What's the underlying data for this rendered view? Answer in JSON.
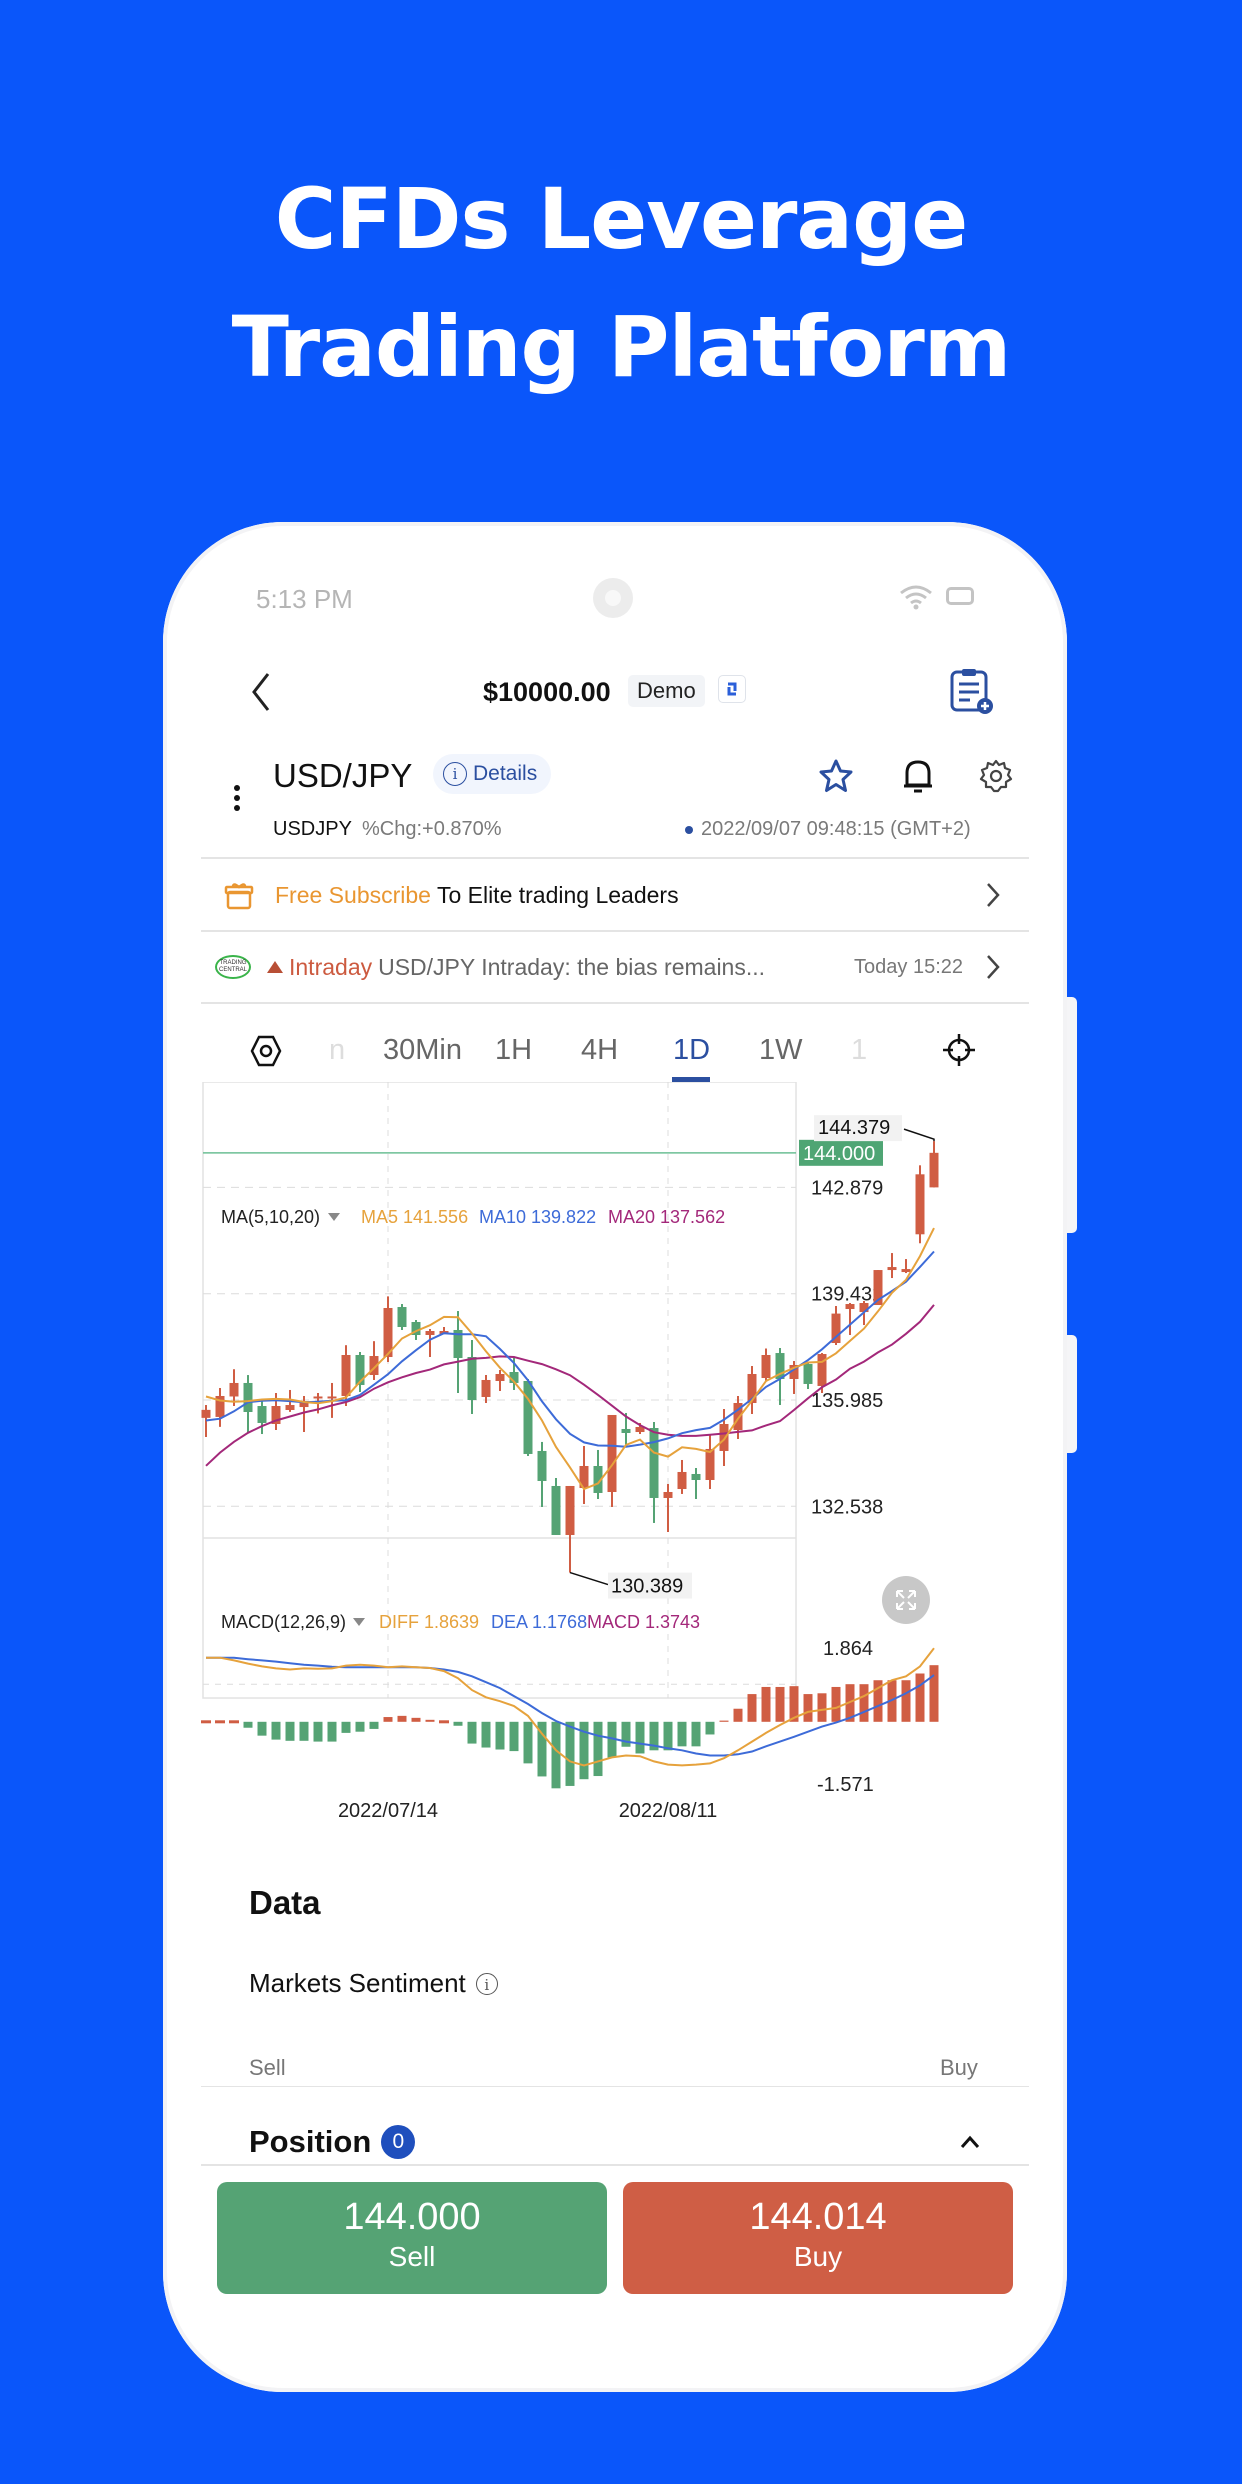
{
  "headline": {
    "line1": "CFDs Leverage",
    "line2": "Trading Platform"
  },
  "status_bar": {
    "time": "5:13 PM",
    "icons": [
      "wifi-icon",
      "battery-icon"
    ]
  },
  "header": {
    "balance": "$10000.00",
    "account_type": "Demo",
    "icons": [
      "back-icon",
      "switch-account-icon",
      "orders-icon"
    ]
  },
  "instrument": {
    "pair": "USD/JPY",
    "details_label": "Details",
    "symbol": "USDJPY",
    "change": "%Chg:+0.870%",
    "timestamp": "2022/09/07 09:48:15 (GMT+2)",
    "icons": [
      "more-icon",
      "favorite-star-icon",
      "alert-bell-icon",
      "settings-gear-icon"
    ]
  },
  "subscribe_banner": {
    "highlight": "Free Subscribe",
    "text": " To Elite trading Leaders"
  },
  "news": {
    "source_logo": "TRADING CENTRAL",
    "tag": "Intraday",
    "headline": "USD/JPY Intraday: the bias remains...",
    "time": "Today 15:22"
  },
  "timeframes": {
    "items": [
      "n",
      "30Min",
      "1H",
      "4H",
      "1D",
      "1W",
      "1"
    ],
    "active": "1D"
  },
  "colors": {
    "up": "#d05d43",
    "down": "#55a374",
    "accent": "#2b4fa0",
    "ma5": "#e6a23c",
    "ma10": "#3d6bd8",
    "ma20": "#a3287a",
    "background": "#0a56fa"
  },
  "chart_data": {
    "type": "candlestick",
    "title": "USD/JPY 1D",
    "main_indicator": {
      "label": "MA(5,10,20)",
      "ma5": "MA5 141.556",
      "ma10": "MA10 139.822",
      "ma20": "MA20 137.562"
    },
    "y_ticks": [
      "142.879",
      "139.432",
      "135.985",
      "132.538"
    ],
    "y_tick_values": [
      142.879,
      139.432,
      135.985,
      132.538
    ],
    "ylim": [
      129.3,
      145.9
    ],
    "current_price": "144.000",
    "current_price_value": 144.0,
    "max_label": "144.379",
    "min_label": "130.389",
    "x_labels": [
      {
        "label": "2022/07/14",
        "index": 13
      },
      {
        "label": "2022/08/11",
        "index": 33
      }
    ],
    "candles": [
      {
        "o": 135.406,
        "h": 135.822,
        "c": 135.665,
        "l": 134.785
      },
      {
        "o": 135.436,
        "h": 136.374,
        "c": 136.115,
        "l": 135.114
      },
      {
        "o": 136.099,
        "h": 136.983,
        "c": 136.537,
        "l": 135.79
      },
      {
        "o": 136.537,
        "h": 136.794,
        "c": 135.596,
        "l": 134.915
      },
      {
        "o": 135.79,
        "h": 136.0,
        "c": 135.24,
        "l": 134.882
      },
      {
        "o": 135.207,
        "h": 136.212,
        "c": 135.79,
        "l": 135.012
      },
      {
        "o": 135.661,
        "h": 136.31,
        "c": 135.822,
        "l": 135.6
      },
      {
        "o": 135.757,
        "h": 136.115,
        "c": 135.95,
        "l": 134.947
      },
      {
        "o": 136.099,
        "h": 136.212,
        "c": 136.099,
        "l": 135.55
      },
      {
        "o": 136.099,
        "h": 136.537,
        "c": 136.099,
        "l": 135.405
      },
      {
        "o": 136.115,
        "h": 137.762,
        "c": 137.444,
        "l": 135.79
      },
      {
        "o": 137.444,
        "h": 137.541,
        "c": 136.472,
        "l": 136.245
      },
      {
        "o": 136.796,
        "h": 137.893,
        "c": 137.411,
        "l": 136.634
      },
      {
        "o": 137.379,
        "h": 139.345,
        "c": 138.968,
        "l": 137.217
      },
      {
        "o": 139.0,
        "h": 139.097,
        "c": 138.352,
        "l": 138.255
      },
      {
        "o": 138.514,
        "h": 138.579,
        "c": 138.093,
        "l": 137.931
      },
      {
        "o": 138.093,
        "h": 138.287,
        "c": 138.222,
        "l": 137.379
      },
      {
        "o": 138.125,
        "h": 138.352,
        "c": 138.222,
        "l": 138.125
      },
      {
        "o": 138.255,
        "h": 138.87,
        "c": 137.347,
        "l": 136.212
      },
      {
        "o": 137.379,
        "h": 137.931,
        "c": 135.985,
        "l": 135.531
      },
      {
        "o": 136.083,
        "h": 136.796,
        "c": 136.634,
        "l": 135.888
      },
      {
        "o": 136.601,
        "h": 136.958,
        "c": 136.828,
        "l": 136.277
      },
      {
        "o": 136.893,
        "h": 137.379,
        "c": 136.537,
        "l": 136.31
      },
      {
        "o": 136.601,
        "h": 136.666,
        "c": 134.235,
        "l": 134.17
      },
      {
        "o": 134.332,
        "h": 134.625,
        "c": 133.359,
        "l": 132.516
      },
      {
        "o": 133.197,
        "h": 133.456,
        "c": 131.608,
        "l": 131.608
      },
      {
        "o": 131.608,
        "h": 133.197,
        "c": 133.197,
        "l": 130.389
      },
      {
        "o": 133.132,
        "h": 134.494,
        "c": 133.845,
        "l": 132.613
      },
      {
        "o": 133.845,
        "h": 134.365,
        "c": 132.97,
        "l": 132.775
      },
      {
        "o": 133.002,
        "h": 135.499,
        "c": 135.499,
        "l": 132.516
      },
      {
        "o": 135.045,
        "h": 135.564,
        "c": 134.915,
        "l": 134.494
      },
      {
        "o": 134.947,
        "h": 135.24,
        "c": 135.11,
        "l": 134.882
      },
      {
        "o": 135.077,
        "h": 135.272,
        "c": 132.808,
        "l": 131.998
      },
      {
        "o": 132.808,
        "h": 133.262,
        "c": 133.002,
        "l": 131.705
      },
      {
        "o": 133.099,
        "h": 134.04,
        "c": 133.651,
        "l": 132.938
      },
      {
        "o": 133.586,
        "h": 133.78,
        "c": 133.391,
        "l": 132.775
      },
      {
        "o": 133.391,
        "h": 134.85,
        "c": 134.397,
        "l": 133.099
      },
      {
        "o": 134.332,
        "h": 135.693,
        "c": 135.207,
        "l": 133.845
      },
      {
        "o": 135.012,
        "h": 136.115,
        "c": 135.888,
        "l": 134.721
      },
      {
        "o": 135.888,
        "h": 137.087,
        "c": 136.828,
        "l": 135.531
      },
      {
        "o": 136.698,
        "h": 137.655,
        "c": 137.444,
        "l": 136.601
      },
      {
        "o": 137.508,
        "h": 137.671,
        "c": 136.666,
        "l": 135.823
      },
      {
        "o": 136.666,
        "h": 137.249,
        "c": 137.12,
        "l": 136.18
      },
      {
        "o": 137.152,
        "h": 137.185,
        "c": 136.505,
        "l": 136.342
      },
      {
        "o": 136.44,
        "h": 137.508,
        "c": 137.476,
        "l": 136.212
      },
      {
        "o": 137.833,
        "h": 139.033,
        "c": 138.787,
        "l": 137.768
      },
      {
        "o": 138.935,
        "h": 139.13,
        "c": 139.097,
        "l": 138.093
      },
      {
        "o": 138.838,
        "h": 139.195,
        "c": 139.13,
        "l": 138.416
      },
      {
        "o": 139.065,
        "h": 140.199,
        "c": 140.199,
        "l": 139.065
      },
      {
        "o": 140.199,
        "h": 140.75,
        "c": 140.296,
        "l": 139.94
      },
      {
        "o": 140.134,
        "h": 140.555,
        "c": 140.231,
        "l": 140.101
      },
      {
        "o": 141.358,
        "h": 143.595,
        "c": 143.303,
        "l": 141.067
      },
      {
        "o": 142.879,
        "h": 144.379,
        "c": 144.0,
        "l": 142.879
      }
    ],
    "ma5": [
      136.1,
      135.97,
      135.93,
      135.95,
      136.0,
      136.02,
      136.0,
      135.92,
      135.88,
      135.95,
      136.07,
      136.58,
      137.02,
      137.48,
      137.98,
      138.22,
      138.41,
      138.68,
      138.67,
      138.14,
      137.56,
      137.03,
      136.58,
      136.02,
      135.32,
      134.46,
      133.8,
      133.1,
      133.28,
      133.87,
      134.53,
      134.7,
      134.28,
      134.15,
      134.45,
      134.4,
      134.3,
      134.7,
      135.38,
      135.97,
      136.6,
      136.83,
      137.03,
      137.2,
      137.22,
      137.5,
      137.9,
      138.3,
      138.86,
      139.46,
      139.88,
      140.65,
      141.56
    ],
    "ma10": [
      135.32,
      135.38,
      135.62,
      135.91,
      135.96,
      135.98,
      135.95,
      135.91,
      135.93,
      135.96,
      135.98,
      136.15,
      136.48,
      136.82,
      137.24,
      137.6,
      137.94,
      138.15,
      138.12,
      138.12,
      138.05,
      137.64,
      137.18,
      136.62,
      135.94,
      135.36,
      134.89,
      134.61,
      134.51,
      134.5,
      134.47,
      134.54,
      134.62,
      134.74,
      134.91,
      135.01,
      135.08,
      135.35,
      135.67,
      136.02,
      136.41,
      136.67,
      136.98,
      137.28,
      137.63,
      138.03,
      138.43,
      138.83,
      139.23,
      139.52,
      139.82,
      140.3,
      140.8
    ],
    "ma20": [
      133.85,
      134.28,
      134.63,
      134.92,
      135.14,
      135.32,
      135.45,
      135.58,
      135.68,
      135.81,
      135.92,
      136.08,
      136.35,
      136.56,
      136.72,
      136.86,
      136.97,
      137.14,
      137.23,
      137.32,
      137.35,
      137.4,
      137.38,
      137.26,
      137.15,
      136.98,
      136.79,
      136.48,
      136.15,
      135.8,
      135.45,
      135.17,
      134.94,
      134.86,
      134.82,
      134.82,
      134.86,
      134.9,
      134.95,
      135.0,
      135.16,
      135.3,
      135.66,
      136.04,
      136.4,
      136.65,
      137.0,
      137.23,
      137.53,
      137.78,
      138.13,
      138.52,
      139.07
    ],
    "macd_indicator": {
      "label": "MACD(12,26,9)",
      "diff": "DIFF 1.8639",
      "dea": "DEA 1.1768",
      "macd": "MACD 1.3743"
    },
    "macd_y_ticks": [
      "1.864",
      "-1.571"
    ],
    "macd_ylim": [
      -1.571,
      1.864
    ],
    "macd_hist": [
      0.0,
      0.0,
      0.0,
      -0.15,
      -0.35,
      -0.45,
      -0.48,
      -0.48,
      -0.5,
      -0.5,
      -0.28,
      -0.25,
      -0.18,
      0.12,
      0.15,
      0.1,
      0.05,
      0.0,
      -0.1,
      -0.55,
      -0.65,
      -0.7,
      -0.74,
      -1.05,
      -1.38,
      -1.68,
      -1.62,
      -1.45,
      -1.37,
      -0.9,
      -0.63,
      -0.8,
      -0.72,
      -0.72,
      -0.62,
      -0.62,
      -0.32,
      0.03,
      0.33,
      0.7,
      0.88,
      0.88,
      0.9,
      0.7,
      0.72,
      0.88,
      0.95,
      0.95,
      1.05,
      1.05,
      1.05,
      1.22,
      1.43
    ],
    "macd_diff": [
      1.62,
      1.62,
      1.55,
      1.47,
      1.4,
      1.35,
      1.32,
      1.35,
      1.34,
      1.35,
      1.42,
      1.44,
      1.42,
      1.38,
      1.4,
      1.38,
      1.36,
      1.28,
      1.1,
      0.8,
      0.62,
      0.52,
      0.4,
      0.15,
      -0.3,
      -0.72,
      -1.0,
      -1.1,
      -1.0,
      -0.9,
      -0.85,
      -0.87,
      -1.0,
      -1.08,
      -1.1,
      -1.08,
      -1.05,
      -0.92,
      -0.72,
      -0.5,
      -0.28,
      -0.08,
      0.1,
      0.25,
      0.3,
      0.35,
      0.5,
      0.65,
      0.85,
      1.05,
      1.15,
      1.4,
      1.86
    ],
    "macd_dea": [
      1.62,
      1.62,
      1.62,
      1.58,
      1.55,
      1.52,
      1.48,
      1.44,
      1.42,
      1.39,
      1.38,
      1.38,
      1.38,
      1.38,
      1.38,
      1.38,
      1.36,
      1.32,
      1.26,
      1.15,
      1.0,
      0.85,
      0.65,
      0.45,
      0.22,
      0.02,
      -0.12,
      -0.25,
      -0.35,
      -0.42,
      -0.5,
      -0.55,
      -0.6,
      -0.67,
      -0.72,
      -0.8,
      -0.85,
      -0.85,
      -0.82,
      -0.75,
      -0.62,
      -0.5,
      -0.38,
      -0.25,
      -0.12,
      -0.02,
      0.1,
      0.25,
      0.4,
      0.55,
      0.72,
      0.92,
      1.18
    ]
  },
  "data_section": {
    "title": "Data",
    "sentiment_label": "Markets Sentiment",
    "sell_label": "Sell",
    "buy_label": "Buy"
  },
  "position": {
    "title": "Position",
    "count": "0"
  },
  "trade": {
    "sell_price": "144.000",
    "sell_label": "Sell",
    "buy_price": "144.014",
    "buy_label": "Buy"
  }
}
